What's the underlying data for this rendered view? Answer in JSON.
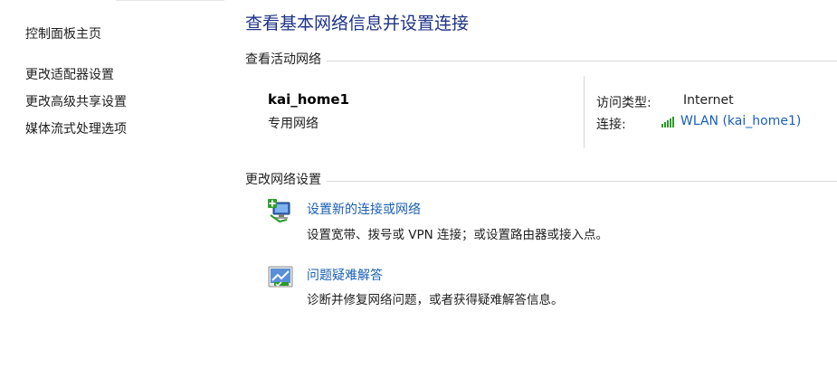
{
  "left_pane": {
    "home": "控制面板主页",
    "links": [
      "更改适配器设置",
      "更改高级共享设置",
      "媒体流式处理选项"
    ]
  },
  "main": {
    "title": "查看基本网络信息并设置连接",
    "active_section": "查看活动网络",
    "network": {
      "name": "kai_home1",
      "profile": "专用网络",
      "access_type_label": "访问类型:",
      "access_type_value": "Internet",
      "connection_label": "连接:",
      "connection_value": "WLAN (kai_home1)",
      "signal_icon": "wifi-signal-icon"
    },
    "change_section": "更改网络设置",
    "tasks": [
      {
        "icon": "new-connection-icon",
        "title": "设置新的连接或网络",
        "desc": "设置宽带、拨号或 VPN 连接；或设置路由器或接入点。"
      },
      {
        "icon": "troubleshoot-icon",
        "title": "问题疑难解答",
        "desc": "诊断并修复网络问题，或者获得疑难解答信息。"
      }
    ]
  },
  "colors": {
    "title": "#1e3287",
    "link": "#1a5fb4",
    "signal": "#2a9a2a",
    "rule": "#d8d8d8"
  }
}
